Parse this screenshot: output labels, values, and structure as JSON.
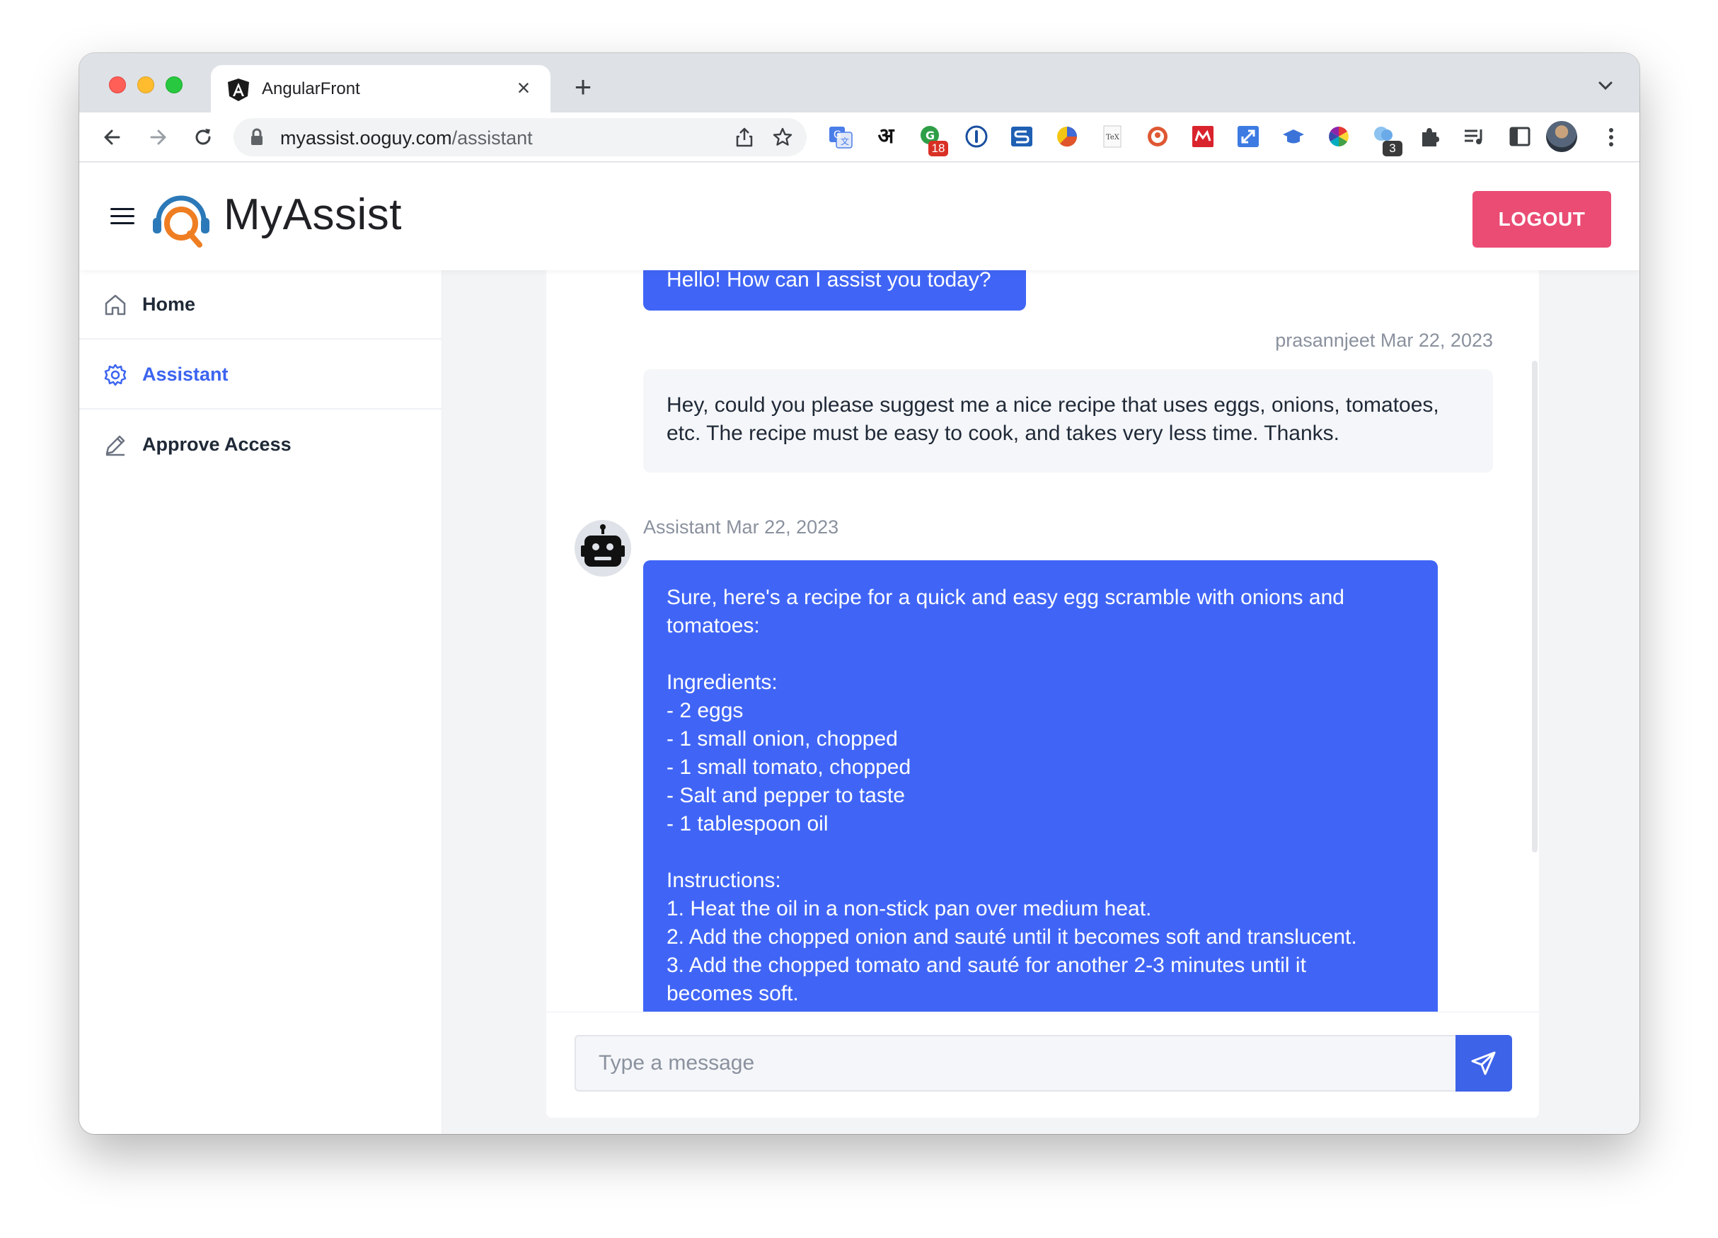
{
  "browser": {
    "tab_title": "AngularFront",
    "new_tab_label": "+",
    "url_host": "myassist.ooguy.com",
    "url_path": "/assistant",
    "extension_badges": [
      "18",
      "3"
    ],
    "extension_glyph": "अ"
  },
  "header": {
    "brand": "MyAssist",
    "logout_label": "LOGOUT"
  },
  "sidebar": {
    "items": [
      {
        "label": "Home",
        "icon": "home-icon",
        "active": false
      },
      {
        "label": "Assistant",
        "icon": "gear-icon",
        "active": true
      },
      {
        "label": "Approve Access",
        "icon": "pencil-icon",
        "active": false
      }
    ]
  },
  "chat": {
    "messages": [
      {
        "role": "bot",
        "text": "Hello! How can I assist you today?"
      },
      {
        "role": "user",
        "author": "prasannjeet",
        "date": "Mar 22, 2023",
        "lines": [
          "Hey, could you please suggest me a nice recipe that uses eggs, onions, tomatoes,",
          "etc. The recipe must be easy to cook, and takes very less time. Thanks."
        ]
      },
      {
        "role": "bot",
        "author": "Assistant",
        "date": "Mar 22, 2023",
        "lines": [
          "Sure, here's a recipe for a quick and easy egg scramble with onions and",
          "tomatoes:",
          "",
          "Ingredients:",
          "- 2 eggs",
          "- 1 small onion, chopped",
          "- 1 small tomato, chopped",
          "- Salt and pepper to taste",
          "- 1 tablespoon oil",
          "",
          "Instructions:",
          "1. Heat the oil in a non-stick pan over medium heat.",
          "2. Add the chopped onion and sauté until it becomes soft and translucent.",
          "3. Add the chopped tomato and sauté for another 2-3 minutes until it",
          "becomes soft."
        ]
      }
    ],
    "input_placeholder": "Type a message"
  },
  "colors": {
    "accent": "#4065f6",
    "logout": "#ea4c74",
    "active_nav": "#3c64f0"
  }
}
